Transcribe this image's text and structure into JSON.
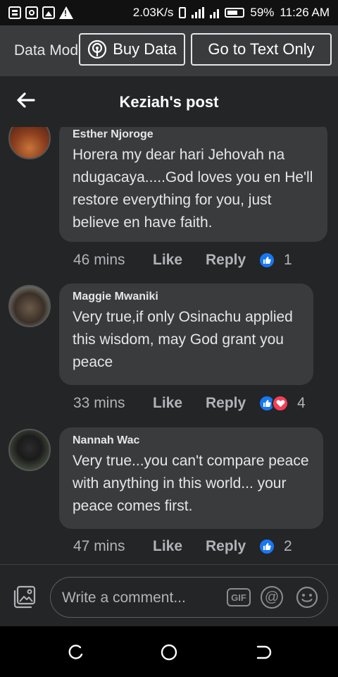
{
  "status_bar": {
    "speed": "2.03K/s",
    "battery": "59%",
    "time": "11:26 AM"
  },
  "banner": {
    "data_mode_label": "Data Mode",
    "buy_data_label": "Buy Data",
    "text_only_label": "Go to Text Only"
  },
  "header": {
    "title": "Keziah's post"
  },
  "comments": [
    {
      "author": "Esther Njoroge",
      "text": "Horera my dear hari Jehovah na ndugacaya.....God loves you en He'll restore everything for you, just believe en have faith.",
      "time": "46 mins",
      "like_label": "Like",
      "reply_label": "Reply",
      "reactions": [
        "like"
      ],
      "reaction_count": "1"
    },
    {
      "author": "Maggie Mwaniki",
      "text": "Very true,if only Osinachu applied this wisdom, may God grant you peace",
      "time": "33 mins",
      "like_label": "Like",
      "reply_label": "Reply",
      "reactions": [
        "like",
        "love"
      ],
      "reaction_count": "4"
    },
    {
      "author": "Nannah Wac",
      "text": "Very true...you can't compare peace with anything in this world... your peace comes first.",
      "time": "47 mins",
      "like_label": "Like",
      "reply_label": "Reply",
      "reactions": [
        "like"
      ],
      "reaction_count": "2"
    }
  ],
  "composer": {
    "placeholder": "Write a comment...",
    "gif_label": "GIF",
    "at_label": "@"
  },
  "colors": {
    "like_blue": "#1877f2",
    "love_red": "#f33e58",
    "bubble": "#3a3b3c",
    "background": "#242526"
  },
  "icons": [
    "photo-icon",
    "gif-icon",
    "mention-icon",
    "emoji-icon",
    "back-arrow-icon",
    "hotspot-icon"
  ]
}
